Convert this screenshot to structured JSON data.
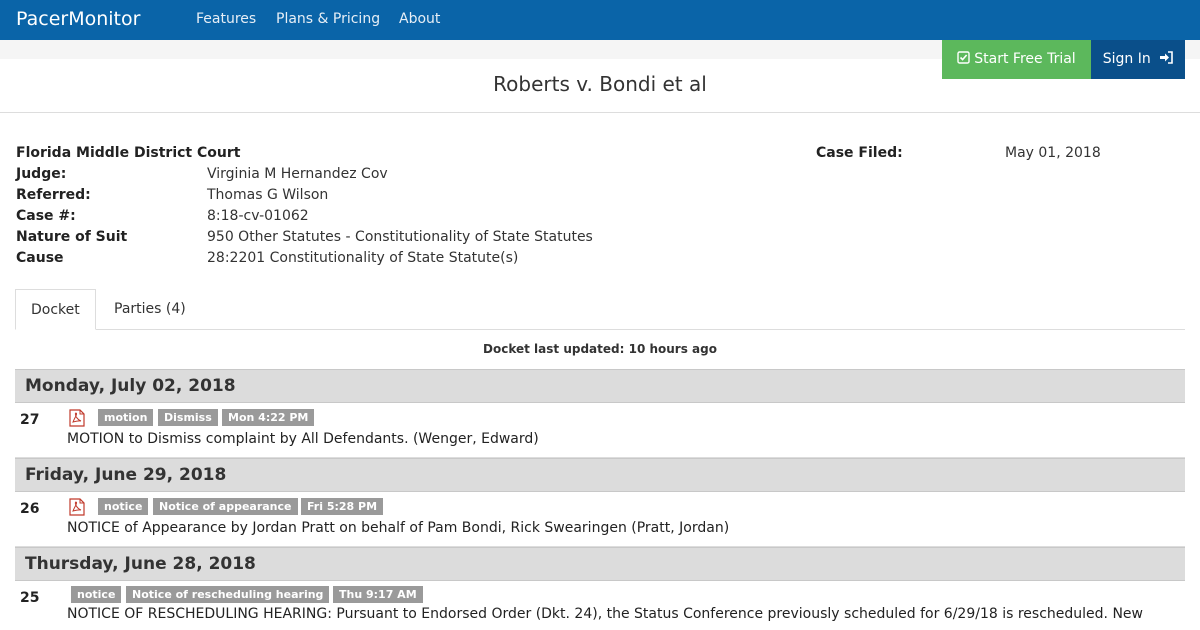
{
  "nav": {
    "brand": "PacerMonitor",
    "links": [
      "Features",
      "Plans & Pricing",
      "About"
    ],
    "trial_label": "Start Free Trial",
    "signin_label": "Sign In"
  },
  "case": {
    "title": "Roberts v. Bondi et al",
    "court": "Florida Middle District Court",
    "fields": [
      {
        "label": "Judge:",
        "value": "Virginia M Hernandez Cov"
      },
      {
        "label": "Referred:",
        "value": "Thomas G Wilson"
      },
      {
        "label": "Case #:",
        "value": "8:18-cv-01062"
      },
      {
        "label": "Nature of Suit",
        "value": "950 Other Statutes - Constitutionality of State Statutes"
      },
      {
        "label": "Cause",
        "value": "28:2201 Constitutionality of State Statute(s)"
      }
    ],
    "filed_label": "Case Filed:",
    "filed_value": "May 01, 2018"
  },
  "tabs": [
    "Docket",
    "Parties (4)"
  ],
  "docket": {
    "updated": "Docket last updated: 10 hours ago",
    "days": [
      {
        "date": "Monday, July 02, 2018",
        "entries": [
          {
            "num": "27",
            "tags": [
              "motion",
              "Dismiss",
              "Mon 4:22 PM"
            ],
            "text": "MOTION to Dismiss complaint by All Defendants. (Wenger, Edward)"
          }
        ]
      },
      {
        "date": "Friday, June 29, 2018",
        "entries": [
          {
            "num": "26",
            "tags": [
              "notice",
              "Notice of appearance",
              "Fri 5:28 PM"
            ],
            "text": "NOTICE of Appearance by Jordan Pratt on behalf of Pam Bondi, Rick Swearingen (Pratt, Jordan)"
          }
        ]
      },
      {
        "date": "Thursday, June 28, 2018",
        "entries": [
          {
            "num": "25",
            "tags": [
              "notice",
              "Notice of rescheduling hearing",
              "Thu 9:17 AM"
            ],
            "text": "NOTICE OF RESCHEDULING HEARING: Pursuant to Endorsed Order (Dkt. 24), the Status Conference previously scheduled for 6/29/18 is rescheduled. New"
          }
        ]
      }
    ]
  },
  "colors": {
    "navbar": "#0a64a8",
    "trial": "#5cb85c",
    "signin": "#0a4f8a",
    "tag": "#9a9a9a"
  }
}
